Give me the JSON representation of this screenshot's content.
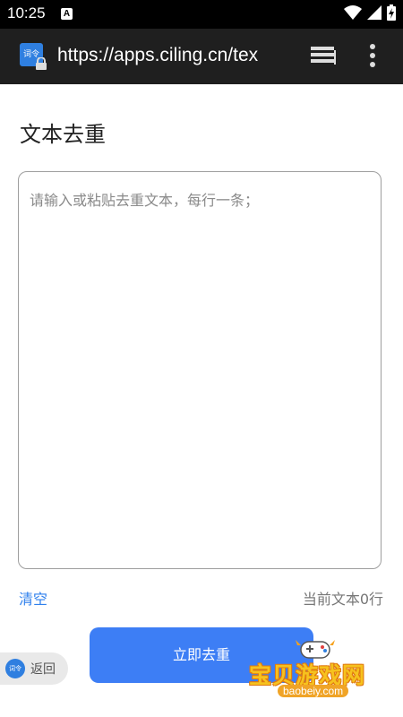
{
  "status_bar": {
    "time": "10:25",
    "notification_letter": "A"
  },
  "browser": {
    "url": "https://apps.ciling.cn/tex",
    "site_icon_text": "词令"
  },
  "page": {
    "title": "文本去重",
    "textarea_placeholder": "请输入或粘贴去重文本，每行一条；",
    "clear_label": "清空",
    "line_count_text": "当前文本0行",
    "dedupe_button_label": "立即去重"
  },
  "floating_back": {
    "logo_text": "词令",
    "label": "返回"
  },
  "watermark": {
    "text": "宝贝游戏网",
    "url": "baobeiy.com"
  },
  "colors": {
    "accent_blue": "#3d7ef5",
    "link_blue": "#2f80ed",
    "appbar_bg": "#1f1f1f",
    "status_bg": "#000000"
  }
}
